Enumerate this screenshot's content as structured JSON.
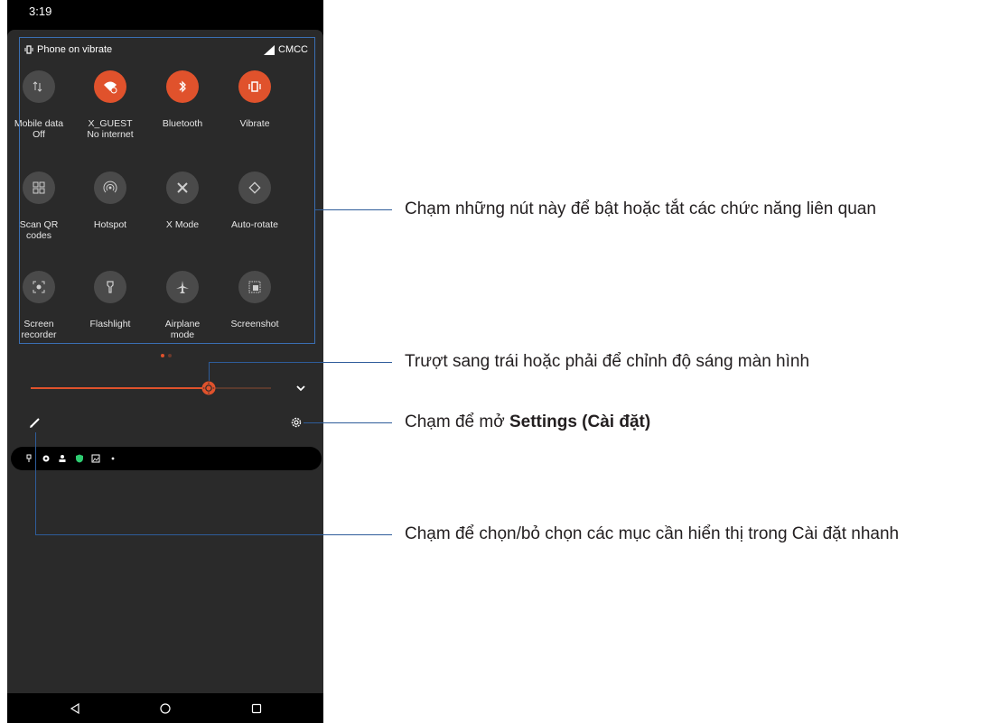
{
  "status_bar": {
    "time": "3:19"
  },
  "quick_settings": {
    "header_left": "Phone on vibrate",
    "header_right": "CMCC",
    "tiles": [
      {
        "line1": "Mobile data",
        "line2": "Off",
        "icon": "mobile-data-icon",
        "active": false
      },
      {
        "line1": "X_GUEST",
        "line2": "No internet",
        "icon": "wifi-icon",
        "active": true
      },
      {
        "line1": "Bluetooth",
        "line2": "",
        "icon": "bluetooth-icon",
        "active": true
      },
      {
        "line1": "Vibrate",
        "line2": "",
        "icon": "vibrate-icon",
        "active": true
      },
      {
        "line1": "Scan QR",
        "line2": "codes",
        "icon": "qr-code-icon",
        "active": false
      },
      {
        "line1": "Hotspot",
        "line2": "",
        "icon": "hotspot-icon",
        "active": false
      },
      {
        "line1": "X Mode",
        "line2": "",
        "icon": "x-mode-icon",
        "active": false
      },
      {
        "line1": "Auto-rotate",
        "line2": "",
        "icon": "auto-rotate-icon",
        "active": false
      },
      {
        "line1": "Screen",
        "line2": "recorder",
        "icon": "screen-recorder-icon",
        "active": false
      },
      {
        "line1": "Flashlight",
        "line2": "",
        "icon": "flashlight-icon",
        "active": false
      },
      {
        "line1": "Airplane",
        "line2": "mode",
        "icon": "airplane-icon",
        "active": false
      },
      {
        "line1": "Screenshot",
        "line2": "",
        "icon": "screenshot-icon",
        "active": false
      }
    ],
    "page_count": 2,
    "current_page": 1
  },
  "brightness": {
    "level": 0.74
  },
  "annotations": {
    "tiles": "Chạm những nút này để bật hoặc tắt các chức năng liên quan",
    "brightness": "Trượt sang trái hoặc phải để chỉnh độ sáng màn hình",
    "settings_prefix": "Chạm để mở ",
    "settings_bold": "Settings (Cài đặt)",
    "edit": "Chạm để chọn/bỏ chọn các mục cần hiển thị trong Cài đặt nhanh"
  },
  "colors": {
    "accent": "#e0522c",
    "tile_off": "#4a4a4a",
    "callout_line": "#2e5c9a",
    "shade_bg": "#2a2a2a"
  }
}
